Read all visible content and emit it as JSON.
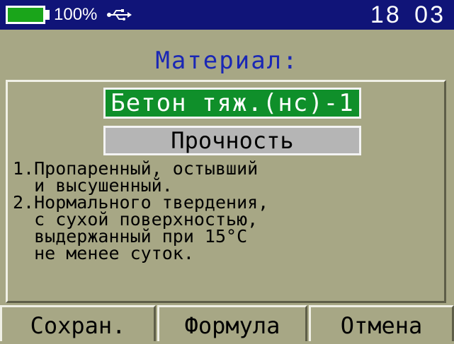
{
  "status_bar": {
    "battery_percent": "100%",
    "battery_level": 1.0,
    "battery_color": "#1aa51a",
    "usb_icon": "usb-icon",
    "time": "18 03"
  },
  "header": {
    "title": "Материал:"
  },
  "material": {
    "selected": "Бетон тяж.(нс)-1",
    "property": "Прочность"
  },
  "description": {
    "lines": [
      "1.Пропаренный, остывший",
      "  и высушенный.",
      "2.Нормального твердения,",
      "  с сухой поверхностью,",
      "  выдержанный при 15°C",
      "  не менее суток."
    ]
  },
  "softkeys": {
    "save": "Сохран.",
    "formula": "Формула",
    "cancel": "Отмена"
  },
  "colors": {
    "status_bar_bg": "#101478",
    "screen_bg": "#a7a785",
    "title_color": "#1a27b5",
    "selected_bg": "#0f8f2a",
    "field_bg": "#b5b5b5"
  }
}
